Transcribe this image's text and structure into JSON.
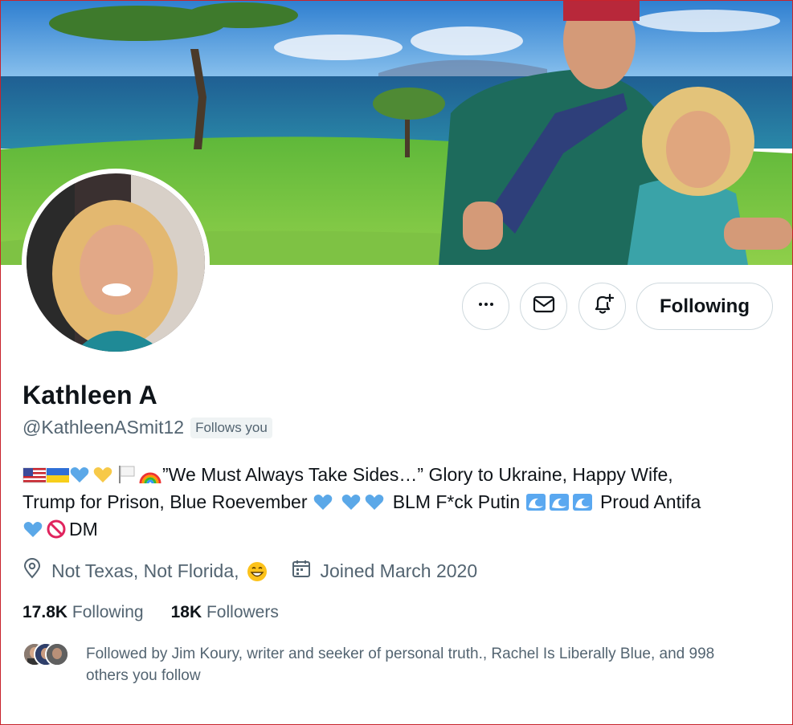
{
  "profile": {
    "name": "Kathleen A",
    "handle": "@KathleenASmit12",
    "follows_you": "Follows you"
  },
  "actions": {
    "more_label": "•••",
    "following_label": "Following",
    "icons": [
      "more-icon",
      "envelope-icon",
      "bell-plus-icon"
    ]
  },
  "bio": {
    "line1": "”We Must Always Take Sides…” Glory to Ukraine, Happy Wife,",
    "line2a": "Trump for Prison, Blue Roevember",
    "line2b": "BLM F*ck Putin",
    "line2c": "Proud Antifa",
    "line3": "DM"
  },
  "meta": {
    "location": "Not Texas, Not Florida,",
    "joined": "Joined March 2020"
  },
  "stats": {
    "following_count": "17.8K",
    "following_label": "Following",
    "followers_count": "18K",
    "followers_label": "Followers"
  },
  "followed_by": {
    "text": "Followed by Jim Koury, writer and seeker of personal truth., Rachel Is Liberally Blue, and 998 others you follow"
  },
  "colors": {
    "text_primary": "#0f1419",
    "text_secondary": "#536471",
    "border": "#cfd9de",
    "badge_bg": "#eff3f4",
    "frame": "#c8232c"
  }
}
